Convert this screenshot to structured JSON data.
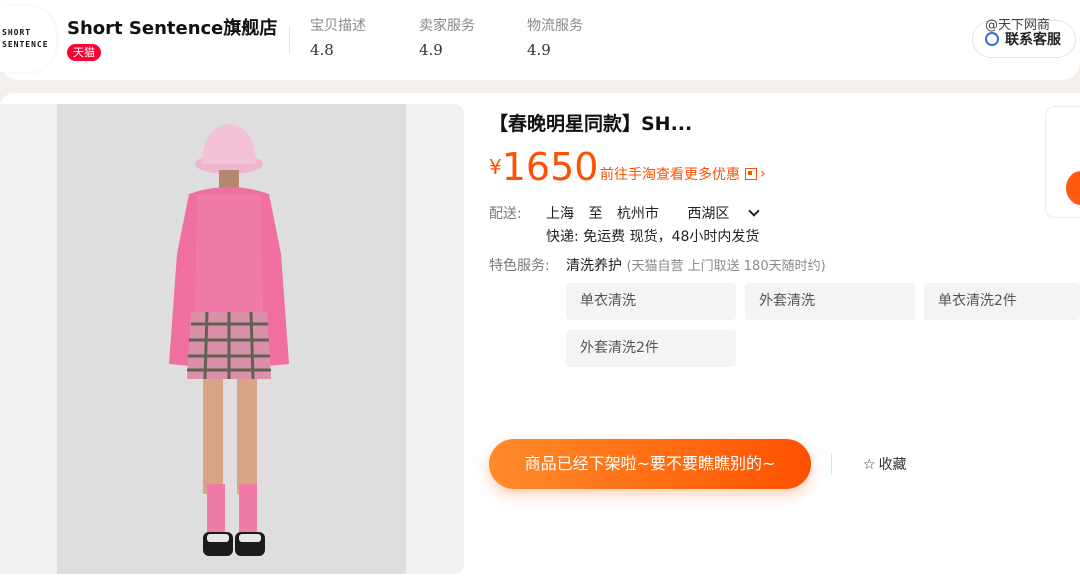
{
  "shop": {
    "logo_line1": "SHORT",
    "logo_line2": "SENTENCE",
    "name": "Short Sentence旗舰店",
    "badge": "天猫",
    "ratings": [
      {
        "label": "宝贝描述",
        "value": "4.8"
      },
      {
        "label": "卖家服务",
        "value": "4.9"
      },
      {
        "label": "物流服务",
        "value": "4.9"
      }
    ],
    "contact_label": "联系客服",
    "watermark": "@天下网商"
  },
  "product": {
    "title": "【春晚明星同款】SH...",
    "currency": "¥",
    "price": "1650",
    "promo_text": "前往手淘查看更多优惠",
    "shipping": {
      "label": "配送:",
      "from": "上海",
      "to_word": "至",
      "city": "杭州市",
      "district": "西湖区",
      "detail": "快递: 免运费  现货，48小时内发货"
    },
    "service": {
      "label": "特色服务:",
      "name": "清洗养护",
      "sub": "(天猫自营  上门取送 180天随时约)",
      "options": [
        "单衣清洗",
        "外套清洗",
        "单衣清洗2件",
        "外套清洗2件"
      ]
    },
    "buy_button": "商品已经下架啦~要不要瞧瞧别的~",
    "favorite_label": "收藏"
  },
  "colors": {
    "accent": "#ff5000",
    "tmall_red": "#ff0036"
  }
}
